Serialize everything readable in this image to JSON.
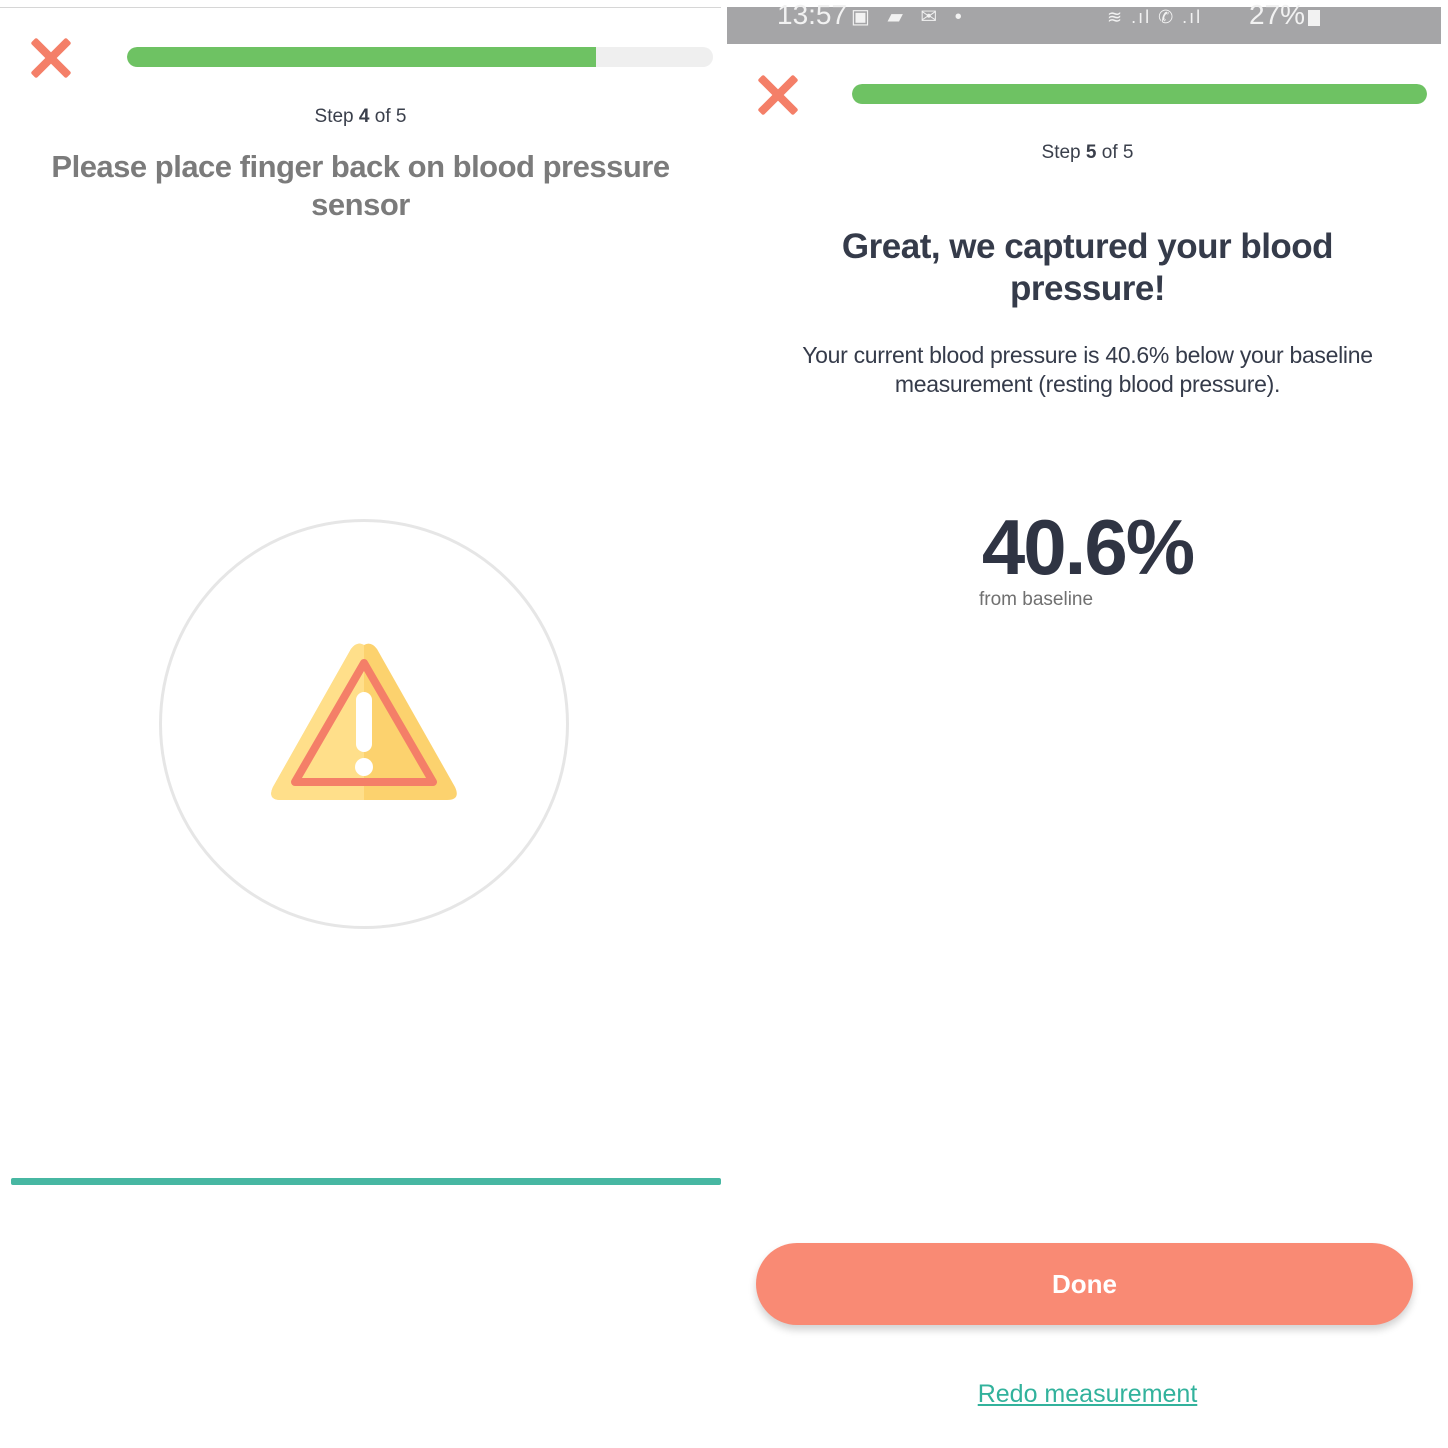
{
  "left_screen": {
    "step": {
      "prefix": "Step",
      "current": "4",
      "suffix": "of 5"
    },
    "progress": 0.8,
    "instruction": "Please place finger back on blood pressure sensor",
    "icon": "warning-triangle-icon",
    "colors": {
      "accent": "#6ec263",
      "close": "#f47f68",
      "bottom_bar": "#47b7a2"
    }
  },
  "right_screen": {
    "status_bar": {
      "time": "13:57",
      "battery": "27%"
    },
    "step": {
      "prefix": "Step",
      "current": "5",
      "suffix": "of 5"
    },
    "progress": 1.0,
    "title": "Great, we captured your blood pressure!",
    "description": "Your current blood pressure is 40.6% below your baseline measurement (resting blood pressure).",
    "value": "40.6%",
    "value_caption": "from baseline",
    "done_label": "Done",
    "redo_label": "Redo measurement",
    "colors": {
      "button": "#f98a74",
      "link": "#32b29c",
      "text": "#353b4a"
    }
  }
}
